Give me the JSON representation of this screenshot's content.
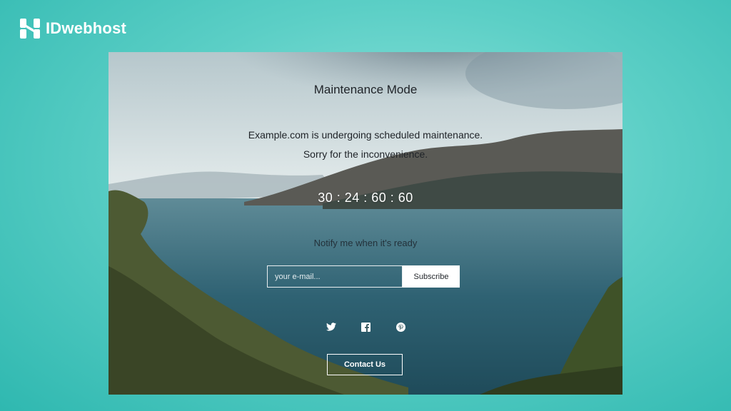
{
  "brand": {
    "name": "IDwebhost"
  },
  "page": {
    "title": "Maintenance Mode",
    "message_line1": "Example.com is undergoing scheduled maintenance.",
    "message_line2": "Sorry for the inconvenience.",
    "countdown": "30 : 24 : 60 : 60",
    "notify_label": "Notify me when it's ready",
    "email_placeholder": "your e-mail...",
    "subscribe_label": "Subscribe",
    "contact_label": "Contact Us"
  },
  "social": [
    {
      "icon": "twitter-icon"
    },
    {
      "icon": "facebook-icon"
    },
    {
      "icon": "pinterest-icon"
    }
  ],
  "colors": {
    "page_bg": "#5ccfc6",
    "text_dark": "#1f2328",
    "text_light": "#ffffff"
  }
}
